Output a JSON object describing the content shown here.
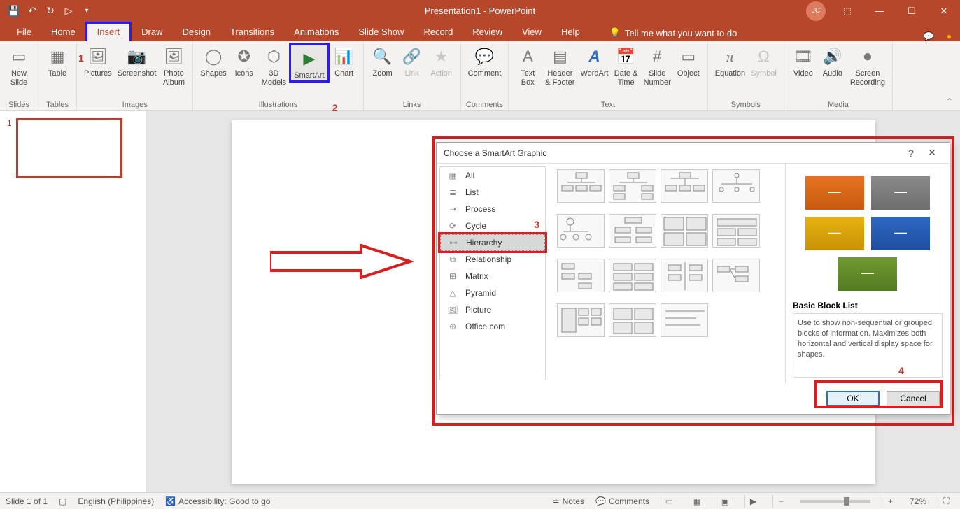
{
  "titlebar": {
    "title": "Presentation1  -  PowerPoint",
    "user_initials": "JC"
  },
  "tabs": {
    "file": "File",
    "home": "Home",
    "insert": "Insert",
    "draw": "Draw",
    "design": "Design",
    "transitions": "Transitions",
    "animations": "Animations",
    "slideshow": "Slide Show",
    "record": "Record",
    "review": "Review",
    "view": "View",
    "help": "Help",
    "tell_me": "Tell me what you want to do"
  },
  "ribbon": {
    "groups": {
      "slides": "Slides",
      "tables": "Tables",
      "images": "Images",
      "illustrations": "Illustrations",
      "links": "Links",
      "comments": "Comments",
      "text": "Text",
      "symbols": "Symbols",
      "media": "Media"
    },
    "new_slide": "New\nSlide",
    "table": "Table",
    "pictures": "Pictures",
    "screenshot": "Screenshot",
    "photo_album": "Photo\nAlbum",
    "shapes": "Shapes",
    "icons": "Icons",
    "models": "3D\nModels",
    "smartart": "SmartArt",
    "chart": "Chart",
    "zoom": "Zoom",
    "link": "Link",
    "action": "Action",
    "comment": "Comment",
    "text_box": "Text\nBox",
    "header_footer": "Header\n& Footer",
    "wordart": "WordArt",
    "date_time": "Date &\nTime",
    "slide_number": "Slide\nNumber",
    "object": "Object",
    "equation": "Equation",
    "symbol": "Symbol",
    "video": "Video",
    "audio": "Audio",
    "screen_recording": "Screen\nRecording"
  },
  "annotations": {
    "n1": "1",
    "n2": "2",
    "n3": "3",
    "n4": "4"
  },
  "slides": {
    "thumb1_num": "1"
  },
  "dialog": {
    "title": "Choose a SmartArt Graphic",
    "help": "?",
    "close": "✕",
    "categories": {
      "all": "All",
      "list": "List",
      "process": "Process",
      "cycle": "Cycle",
      "hierarchy": "Hierarchy",
      "relationship": "Relationship",
      "matrix": "Matrix",
      "pyramid": "Pyramid",
      "picture": "Picture",
      "office": "Office.com"
    },
    "preview_title": "Basic Block List",
    "preview_desc": "Use to show non-sequential or grouped blocks of information. Maximizes both horizontal and vertical display space for shapes.",
    "ok": "OK",
    "cancel": "Cancel"
  },
  "status": {
    "slide": "Slide 1 of 1",
    "lang": "English (Philippines)",
    "access": "Accessibility: Good to go",
    "notes": "Notes",
    "comments": "Comments",
    "zoom_pct": "72%"
  }
}
